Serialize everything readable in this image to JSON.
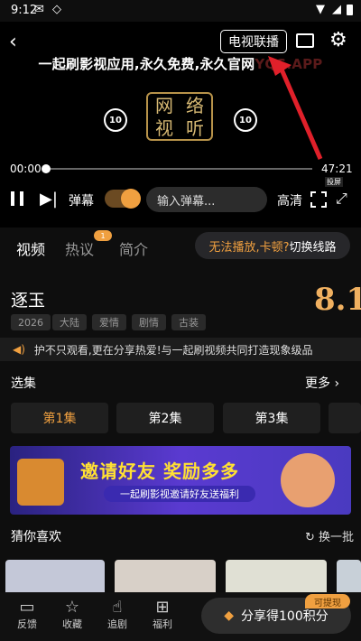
{
  "status": {
    "time": "9:12"
  },
  "player": {
    "tv_cast_label": "电视联播",
    "marquee": "一起刷影视应用,永久免费,永久官网",
    "marquee_tail": "YQS.APP",
    "logo_chars": [
      "网",
      "络",
      "视",
      "听"
    ],
    "seek_back": "10",
    "seek_fwd": "10",
    "current_time": "00:00",
    "total_time": "47:21",
    "danmu_label": "弹幕",
    "danmu_placeholder": "输入弹幕...",
    "quality_label": "高清",
    "fullscreen_badge": "投屏"
  },
  "tabs": {
    "video": "视频",
    "comments": "热议",
    "comments_badge": "1",
    "intro": "简介",
    "problem_warn": "无法播放,卡顿?",
    "problem_action": " 切换线路"
  },
  "show": {
    "title": "逐玉",
    "score": "8.1",
    "tags": [
      "2026",
      "大陆",
      "爱情",
      "剧情",
      "古装"
    ]
  },
  "notice": "护不只观看,更在分享热爱!与一起刷视频共同打造现象级品",
  "episodes": {
    "label": "选集",
    "more": "更多",
    "items": [
      "第1集",
      "第2集",
      "第3集"
    ]
  },
  "banner": {
    "title": "邀请好友  奖励多多",
    "subtitle": "一起刷影视邀请好友送福利"
  },
  "recommend": {
    "label": "猜你喜欢",
    "refresh": "换一批"
  },
  "bottom_nav": {
    "feedback": "反馈",
    "favorites": "收藏",
    "following": "追剧",
    "benefits": "福利",
    "share": "分享得100积分",
    "cash_badge": "可提现"
  },
  "colors": {
    "accent": "#f0a040",
    "score": "#f0b060",
    "annotation_arrow": "#e0202a"
  }
}
